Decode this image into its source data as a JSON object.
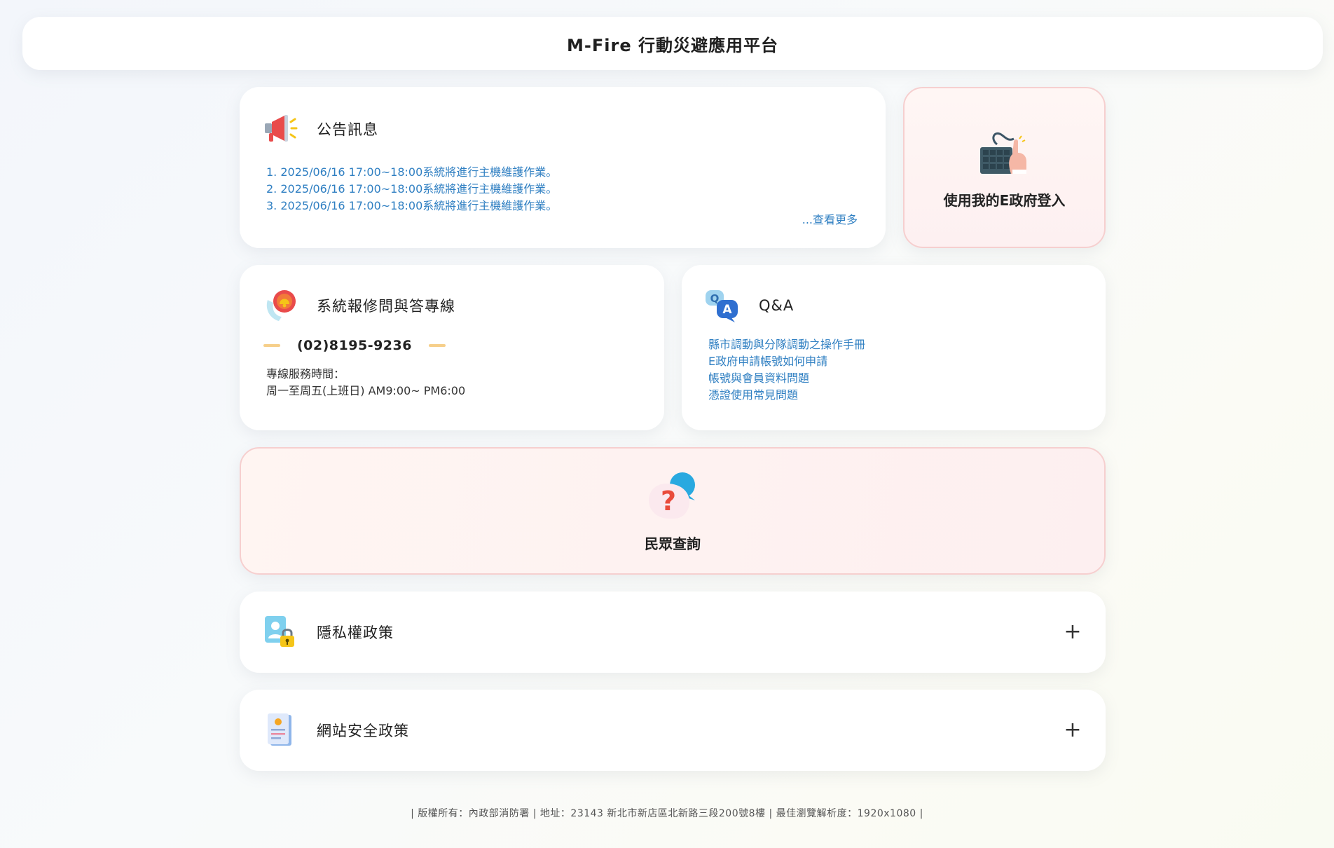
{
  "header": {
    "title": "M-Fire 行動災避應用平台"
  },
  "announcements": {
    "title": "公告訊息",
    "icon": "megaphone-icon",
    "items": [
      "1. 2025/06/16 17:00~18:00系統將進行主機維護作業。",
      "2. 2025/06/16 17:00~18:00系統將進行主機維護作業。",
      "3. 2025/06/16 17:00~18:00系統將進行主機維護作業。"
    ],
    "more_label": "...查看更多"
  },
  "login": {
    "label": "使用我的E政府登入",
    "icon": "keyboard-hand-icon"
  },
  "hotline": {
    "title": "系統報修問與答專線",
    "icon": "phone-bell-icon",
    "phone": "(02)8195-9236",
    "hours_label": "專線服務時間：",
    "hours_value": "周一至周五(上班日) AM9:00~ PM6:00"
  },
  "qa": {
    "title": "Q&A",
    "icon": "qa-bubble-icon",
    "links": [
      "縣市調動與分隊調動之操作手冊",
      "E政府申請帳號如何申請",
      "帳號與會員資料問題",
      "憑證使用常見問題"
    ]
  },
  "query": {
    "label": "民眾查詢",
    "icon": "question-bubble-icon"
  },
  "privacy": {
    "title": "隱私權政策",
    "icon": "user-lock-icon",
    "toggle": "+"
  },
  "security": {
    "title": "網站安全政策",
    "icon": "document-badge-icon",
    "toggle": "+"
  },
  "footer": {
    "text": "| 版權所有：內政部消防署 | 地址：23143 新北市新店區北新路三段200號8樓 | 最佳瀏覽解析度：1920x1080 |"
  },
  "colors": {
    "link": "#2f7fc2",
    "accent_border": "#f6cfcf",
    "dash": "#f6cf8a"
  }
}
